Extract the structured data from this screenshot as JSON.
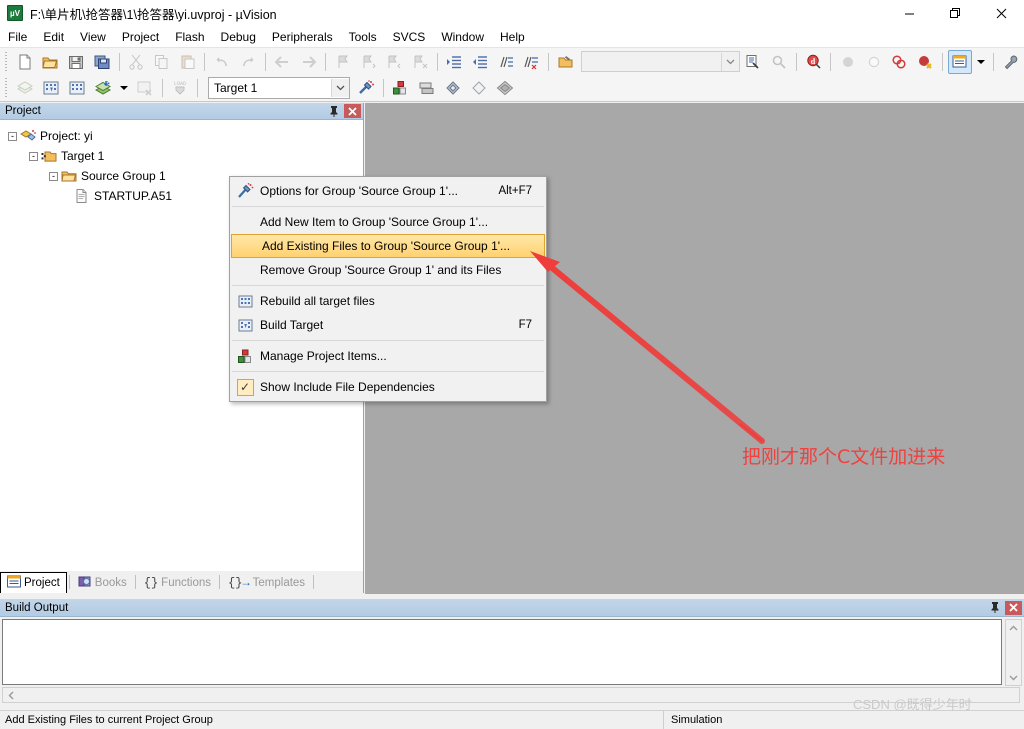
{
  "window": {
    "title": "F:\\单片机\\抢答器\\1\\抢答器\\yi.uvproj - µVision",
    "app_icon": "uvision-icon",
    "minimize": "—",
    "restore": "❐",
    "close": "✕"
  },
  "menubar": {
    "items": [
      {
        "label": "File"
      },
      {
        "label": "Edit"
      },
      {
        "label": "View"
      },
      {
        "label": "Project"
      },
      {
        "label": "Flash"
      },
      {
        "label": "Debug"
      },
      {
        "label": "Peripherals"
      },
      {
        "label": "Tools"
      },
      {
        "label": "SVCS"
      },
      {
        "label": "Window"
      },
      {
        "label": "Help"
      }
    ]
  },
  "toolbar_main": {
    "buttons": [
      {
        "name": "new-file-icon"
      },
      {
        "name": "open-file-icon"
      },
      {
        "name": "save-icon"
      },
      {
        "name": "save-all-icon"
      },
      {
        "name": "cut-icon"
      },
      {
        "name": "copy-icon"
      },
      {
        "name": "paste-icon"
      },
      {
        "name": "undo-icon"
      },
      {
        "name": "redo-icon"
      },
      {
        "name": "navigate-back-icon"
      },
      {
        "name": "navigate-forward-icon"
      },
      {
        "name": "bookmark-toggle-icon"
      },
      {
        "name": "bookmark-prev-icon"
      },
      {
        "name": "bookmark-next-icon"
      },
      {
        "name": "bookmark-clear-icon"
      },
      {
        "name": "indent-right-icon"
      },
      {
        "name": "indent-left-icon"
      },
      {
        "name": "comment-icon"
      },
      {
        "name": "uncomment-icon"
      }
    ],
    "find_placeholder": "",
    "find_value": ""
  },
  "toolbar_build": {
    "target_label": "Target 1",
    "buttons": [
      {
        "name": "translate-icon"
      },
      {
        "name": "build-icon"
      },
      {
        "name": "rebuild-all-icon"
      },
      {
        "name": "batch-build-icon"
      },
      {
        "name": "stop-build-icon"
      },
      {
        "name": "download-icon"
      },
      {
        "name": "target-options-icon"
      },
      {
        "name": "manage-components-icon"
      },
      {
        "name": "manage-run-env-icon"
      },
      {
        "name": "pack-installer-icon"
      },
      {
        "name": "select-software-packs-icon"
      },
      {
        "name": "manage-multi-project-icon"
      }
    ],
    "right_buttons": [
      {
        "name": "open-file-browse-icon"
      },
      {
        "name": "find-in-files-icon"
      },
      {
        "name": "find-next-icon"
      },
      {
        "name": "start-debug-icon"
      },
      {
        "name": "breakpoint-icon"
      },
      {
        "name": "breakpoint-disable-icon"
      },
      {
        "name": "breakpoint-kill-all-icon"
      },
      {
        "name": "breakpoint-disable-all-icon"
      },
      {
        "name": "project-window-toggle-icon"
      },
      {
        "name": "window-dropdown-icon"
      },
      {
        "name": "configuration-wizard-icon"
      }
    ]
  },
  "project_panel": {
    "title": "Project",
    "pin_icon": "pin-icon",
    "close_icon": "close-icon",
    "tree": [
      {
        "label": "Project: yi",
        "level": 0,
        "icon": "project-icon",
        "expander": "-"
      },
      {
        "label": "Target 1",
        "level": 1,
        "icon": "target-icon",
        "expander": "-"
      },
      {
        "label": "Source Group 1",
        "level": 2,
        "icon": "folder-icon",
        "expander": "-"
      },
      {
        "label": "STARTUP.A51",
        "level": 3,
        "icon": "source-file-icon",
        "expander": ""
      }
    ]
  },
  "panel_tabs": [
    {
      "label": "Project",
      "icon": "project-tab-icon",
      "active": true
    },
    {
      "label": "Books",
      "icon": "books-tab-icon",
      "active": false
    },
    {
      "label": "Functions",
      "icon": "functions-tab-icon",
      "active": false
    },
    {
      "label": "Templates",
      "icon": "templates-tab-icon",
      "active": false
    }
  ],
  "context_menu": {
    "items": [
      {
        "label": "Options for Group 'Source Group 1'...",
        "accel": "Alt+F7",
        "icon": "options-wand-icon",
        "highlighted": false,
        "separator_after": true
      },
      {
        "label": "Add New  Item to Group 'Source Group 1'...",
        "accel": "",
        "icon": "",
        "highlighted": false,
        "separator_after": false
      },
      {
        "label": "Add Existing Files to Group 'Source Group 1'...",
        "accel": "",
        "icon": "",
        "highlighted": true,
        "separator_after": false
      },
      {
        "label": "Remove Group 'Source Group 1' and its Files",
        "accel": "",
        "icon": "",
        "highlighted": false,
        "separator_after": true
      },
      {
        "label": "Rebuild all target files",
        "accel": "",
        "icon": "rebuild-icon",
        "highlighted": false,
        "separator_after": false
      },
      {
        "label": "Build Target",
        "accel": "F7",
        "icon": "build-target-icon",
        "highlighted": false,
        "separator_after": true
      },
      {
        "label": "Manage Project Items...",
        "accel": "",
        "icon": "manage-items-icon",
        "highlighted": false,
        "separator_after": true
      },
      {
        "label": "Show Include File Dependencies",
        "accel": "",
        "icon": "checkmark-icon",
        "highlighted": false,
        "separator_after": false
      }
    ]
  },
  "build_output": {
    "title": "Build Output",
    "pin_icon": "pin-icon",
    "close_icon": "close-icon",
    "content": ""
  },
  "statusbar": {
    "message": "Add Existing Files to current Project Group",
    "mode": "Simulation"
  },
  "annotation": {
    "text": "把刚才那个C文件加进来",
    "color": "#f0413f",
    "arrow_color": "#ee3d3b"
  },
  "watermark": {
    "text": "CSDN @既得少年时"
  },
  "colors": {
    "editor_background": "#a8a8a8",
    "panel_header": "#b8cee5",
    "highlight_menu": "#ffd270",
    "close_button_red": "#c75b5b"
  }
}
